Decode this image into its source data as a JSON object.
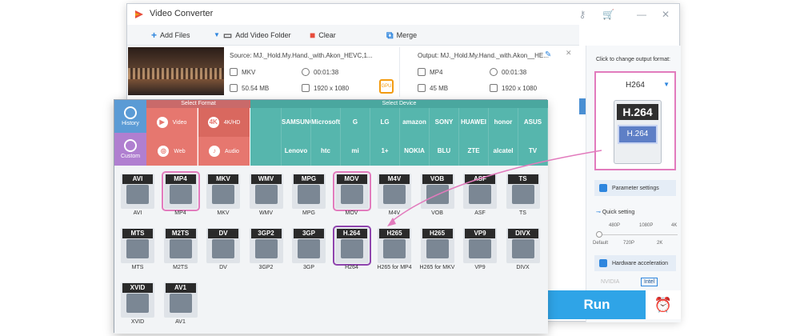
{
  "window": {
    "title": "Video Converter"
  },
  "toolbar": {
    "add_files": "Add Files",
    "add_video_folder": "Add Video Folder",
    "clear": "Clear",
    "merge": "Merge"
  },
  "file": {
    "source": "Source: MJ._Hold.My.Hand._with.Akon_HEVC,1...",
    "src_format": "MKV",
    "src_duration": "00:01:38",
    "src_size": "50.54 MB",
    "src_resolution": "1920 x 1080",
    "gpu": "GPU",
    "output": "Output: MJ._Hold.My.Hand._with.Akon__HE...",
    "out_format": "MP4",
    "out_duration": "00:01:38",
    "out_size": "45 MB",
    "out_resolution": "1920 x 1080"
  },
  "side": {
    "label": "Click to change output format:",
    "format_name": "H264",
    "icon_top": "H.264",
    "icon_mid": "H.264",
    "parameter": "Parameter settings",
    "quick": "Quick setting",
    "ticks_top": [
      "480P",
      "1080P",
      "4K"
    ],
    "ticks_bottom": [
      "Default",
      "720P",
      "2K"
    ],
    "hw_accel": "Hardware acceleration",
    "nvidia": "NVIDIA",
    "intel": "Intel",
    "run": "Run"
  },
  "popup": {
    "select_format": "Select Format",
    "select_device": "Select Device",
    "history": "History",
    "custom": "Custom",
    "cats": [
      "Video",
      "4K/HD",
      "Web",
      "Audio"
    ],
    "brands_row1": [
      "",
      "SAMSUNG",
      "Microsoft",
      "G",
      "LG",
      "amazon",
      "SONY",
      "HUAWEI",
      "honor",
      "ASUS"
    ],
    "brands_row2": [
      "",
      "Lenovo",
      "htc",
      "mi",
      "1+",
      "NOKIA",
      "BLU",
      "ZTE",
      "alcatel",
      "TV"
    ],
    "formats_row1": [
      {
        "tag": "AVI",
        "cap": "AVI"
      },
      {
        "tag": "MP4",
        "cap": "MP4"
      },
      {
        "tag": "MKV",
        "cap": "MKV"
      },
      {
        "tag": "WMV",
        "cap": "WMV"
      },
      {
        "tag": "MPG",
        "cap": "MPG"
      },
      {
        "tag": "MOV",
        "cap": "MOV"
      },
      {
        "tag": "M4V",
        "cap": "M4V"
      },
      {
        "tag": "VOB",
        "cap": "VOB"
      },
      {
        "tag": "ASF",
        "cap": "ASF"
      },
      {
        "tag": "TS",
        "cap": "TS"
      }
    ],
    "formats_row2": [
      {
        "tag": "MTS",
        "cap": "MTS"
      },
      {
        "tag": "M2TS",
        "cap": "M2TS"
      },
      {
        "tag": "DV",
        "cap": "DV"
      },
      {
        "tag": "3GP2",
        "cap": "3GP2"
      },
      {
        "tag": "3GP",
        "cap": "3GP"
      },
      {
        "tag": "H.264",
        "cap": "H264"
      },
      {
        "tag": "H265",
        "cap": "H265 for MP4"
      },
      {
        "tag": "H265",
        "cap": "H265 for MKV"
      },
      {
        "tag": "VP9",
        "cap": "VP9"
      },
      {
        "tag": "DIVX",
        "cap": "DIVX"
      }
    ],
    "formats_row3": [
      {
        "tag": "XVID",
        "cap": "XVID"
      },
      {
        "tag": "AV1",
        "cap": "AV1"
      }
    ]
  },
  "colors": {
    "accent": "#2fa4e7",
    "format_red": "#e6776f",
    "device_teal": "#56b6ad",
    "highlight_pink": "#e27bbd"
  }
}
